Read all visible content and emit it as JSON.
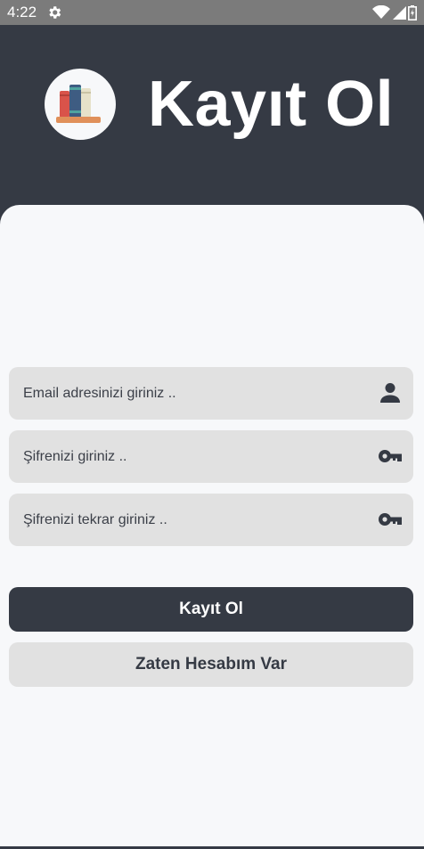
{
  "status_bar": {
    "time": "4:22",
    "icons": [
      "gear-icon",
      "wifi-icon",
      "signal-icon",
      "battery-icon"
    ]
  },
  "header": {
    "title": "Kayıt Ol",
    "logo": "books-icon",
    "background": "#353a44"
  },
  "form": {
    "email_placeholder": "Email adresinizi giriniz ..",
    "password_placeholder": "Şifrenizi giriniz ..",
    "password_repeat_placeholder": "Şifrenizi tekrar giriniz ..",
    "email_icon": "person-icon",
    "password_icon": "key-icon"
  },
  "actions": {
    "register_label": "Kayıt Ol",
    "have_account_label": "Zaten Hesabım Var"
  },
  "colors": {
    "primary": "#353a44",
    "field_bg": "#e1e1e1",
    "card_bg": "#f7f8fa"
  }
}
